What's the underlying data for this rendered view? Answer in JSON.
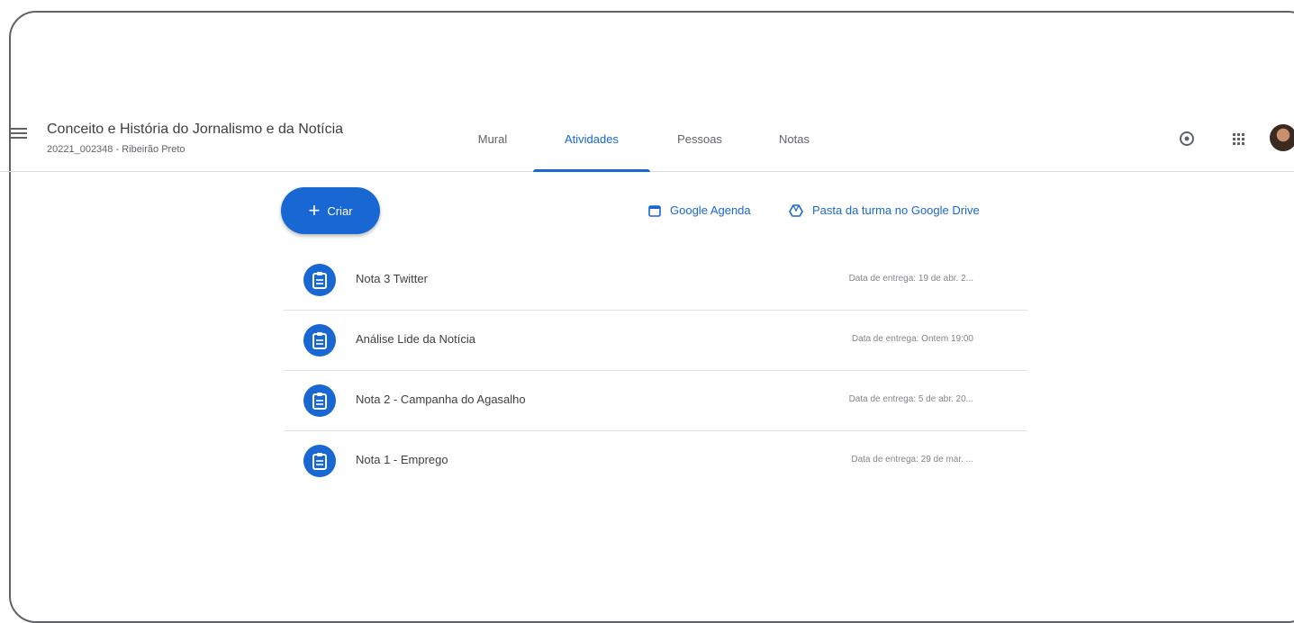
{
  "header": {
    "class_name": "Conceito e História do Jornalismo e da Notícia",
    "class_code": "20221_002348 - Ribeirão Preto",
    "tabs": [
      {
        "label": "Mural"
      },
      {
        "label": "Atividades"
      },
      {
        "label": "Pessoas"
      },
      {
        "label": "Notas"
      }
    ],
    "active_tab": "Atividades",
    "icons": [
      "gear-icon",
      "apps-grid-icon",
      "avatar"
    ]
  },
  "toolbar": {
    "create_label": "Criar",
    "calendar_link": "Google Agenda",
    "drive_link": "Pasta da turma no Google Drive"
  },
  "assignments": [
    {
      "title": "Nota 3 Twitter",
      "due": "Data de entrega: 19 de abr. 2..."
    },
    {
      "title": "Análise Lide da Notícia",
      "due": "Data de entrega: Ontem 19:00"
    },
    {
      "title": "Nota 2 - Campanha do Agasalho",
      "due": "Data de entrega: 5 de abr. 20..."
    },
    {
      "title": "Nota 1 - Emprego",
      "due": "Data de entrega: 29 de mar. ..."
    }
  ],
  "colors": {
    "accent": "#1967d2",
    "text": "#3c4043",
    "muted": "#80868b",
    "divider": "#e0e0e0"
  }
}
